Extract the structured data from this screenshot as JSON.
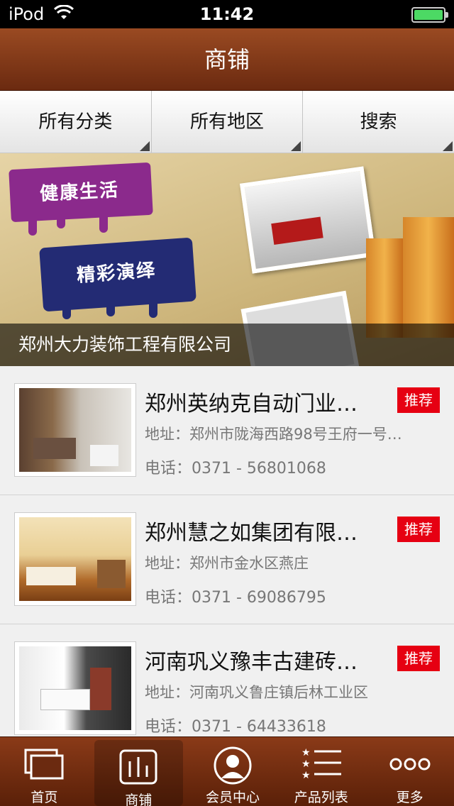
{
  "status": {
    "carrier": "iPod",
    "time": "11:42"
  },
  "navbar": {
    "title": "商铺"
  },
  "filters": [
    {
      "label": "所有分类"
    },
    {
      "label": "所有地区"
    },
    {
      "label": "搜索"
    }
  ],
  "banner": {
    "caption": "郑州大力装饰工程有限公司",
    "slogan1": "健康生活",
    "slogan2": "精彩演绎"
  },
  "shops": [
    {
      "name": "郑州英纳克自动门业…",
      "badge": "推荐",
      "address": "地址：郑州市陇海西路98号王府一号…",
      "phone": "电话：0371 - 56801068"
    },
    {
      "name": "郑州慧之如集团有限…",
      "badge": "推荐",
      "address": "地址：郑州市金水区燕庄",
      "phone": "电话：0371 - 69086795"
    },
    {
      "name": "河南巩义豫丰古建砖…",
      "badge": "推荐",
      "address": "地址：河南巩义鲁庄镇后林工业区",
      "phone": "电话：0371 - 64433618"
    }
  ],
  "tabbar": [
    {
      "label": "首页",
      "icon": "home-icon"
    },
    {
      "label": "商铺",
      "icon": "shop-icon"
    },
    {
      "label": "会员中心",
      "icon": "member-icon"
    },
    {
      "label": "产品列表",
      "icon": "product-list-icon"
    },
    {
      "label": "更多",
      "icon": "more-icon"
    }
  ],
  "colors": {
    "brand": "#7a3214",
    "badge": "#e60012"
  }
}
